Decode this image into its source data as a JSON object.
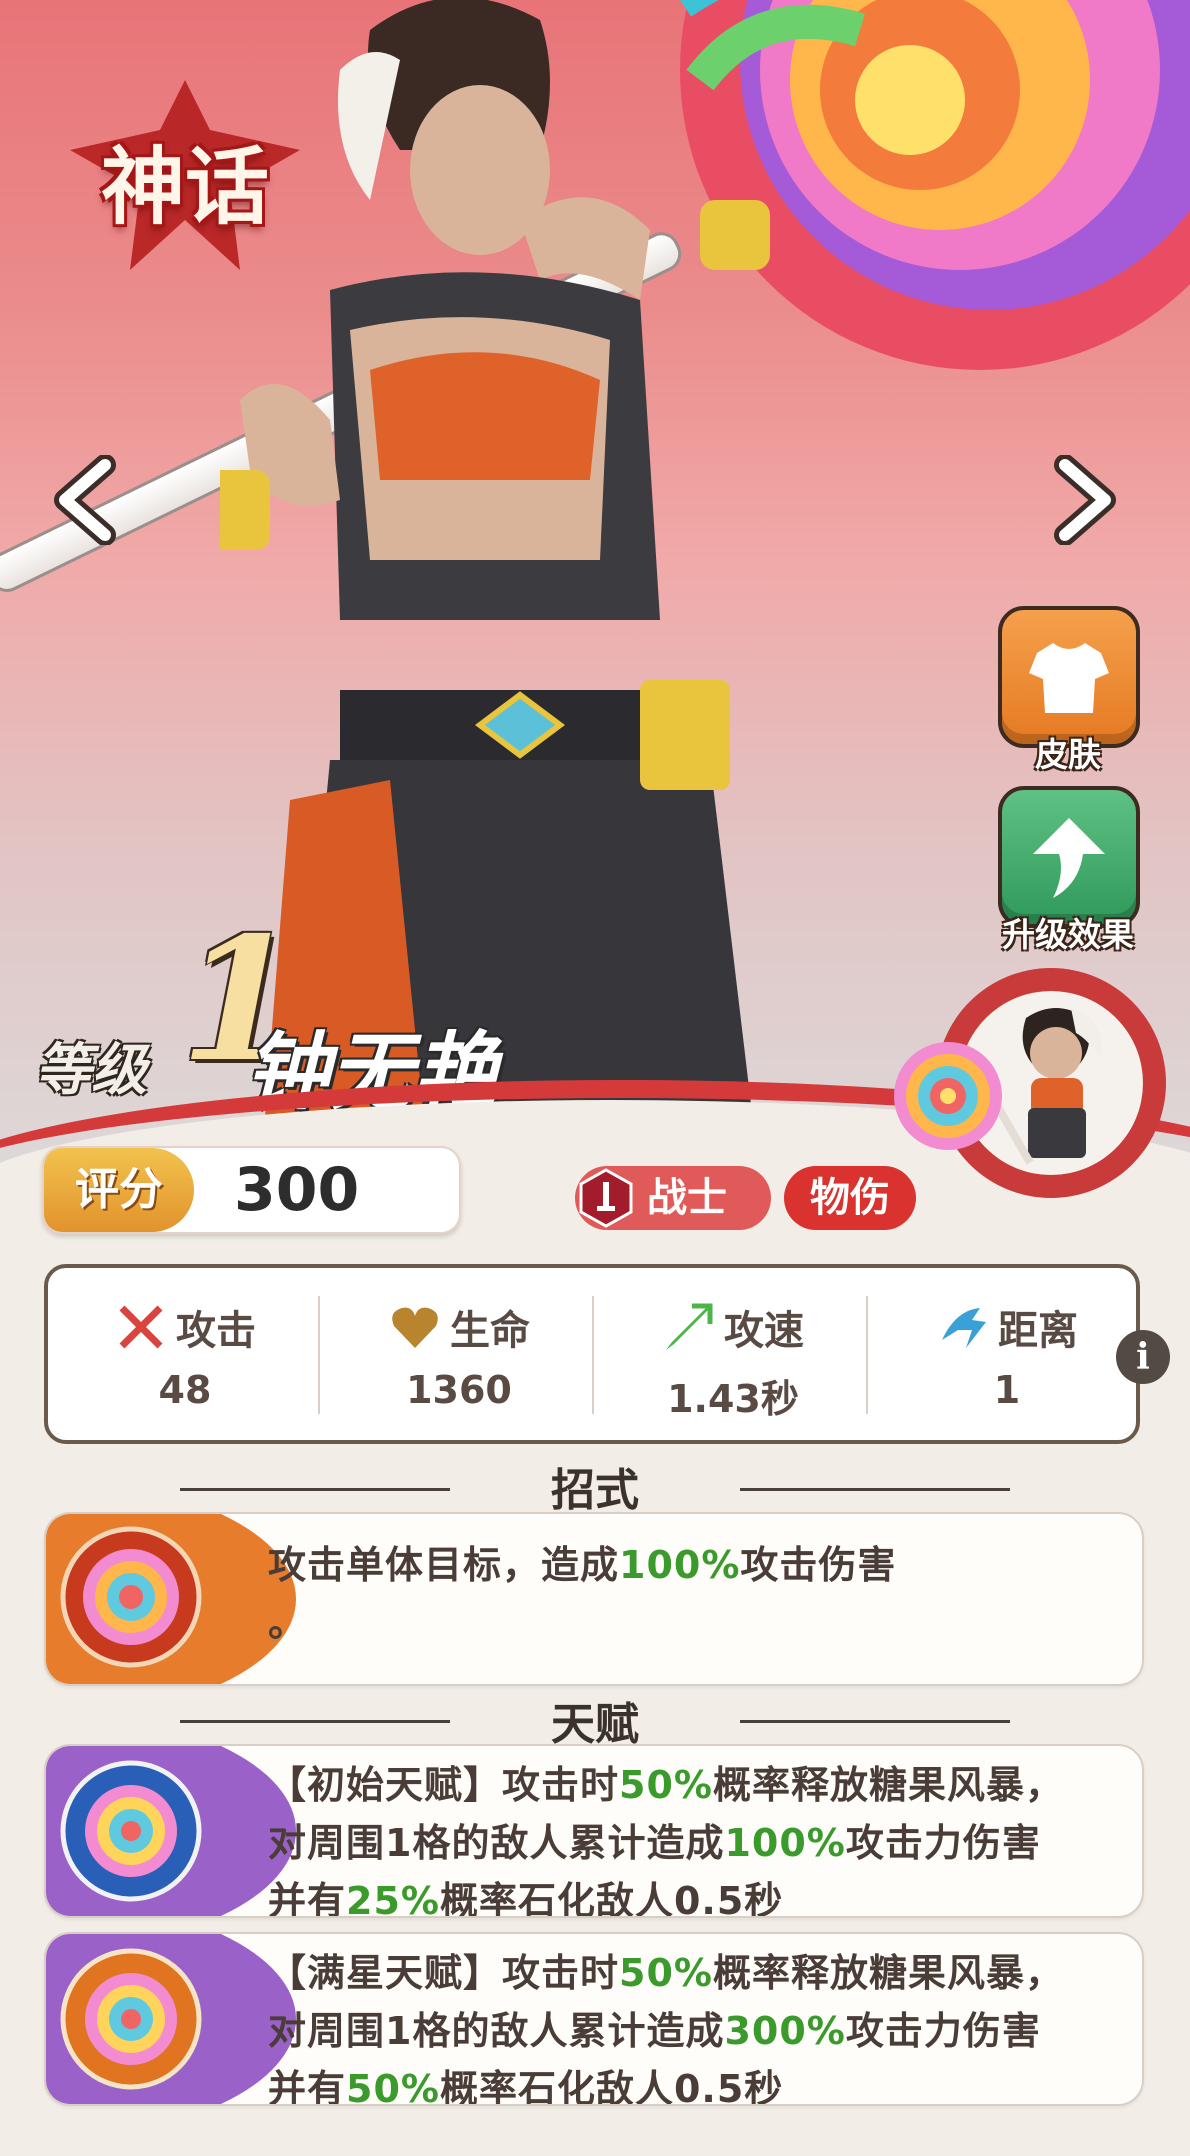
{
  "hero": {
    "rarity_badge": "神话",
    "level_label": "等级",
    "level": "1",
    "name": "钟无艳",
    "score_label": "评分",
    "score": "300",
    "class_tag": "战士",
    "damage_tag": "物伤"
  },
  "side_buttons": {
    "skin": "皮肤",
    "upgrade": "升级效果"
  },
  "stats": [
    {
      "name": "攻击",
      "value": "48",
      "icon": "attack-sword-icon"
    },
    {
      "name": "生命",
      "value": "1360",
      "icon": "heart-icon"
    },
    {
      "name": "攻速",
      "value": "1.43秒",
      "icon": "attack-speed-icon"
    },
    {
      "name": "距离",
      "value": "1",
      "icon": "range-icon"
    }
  ],
  "sections": {
    "moves_title": "招式",
    "talent_title": "天赋"
  },
  "move": {
    "text_a": "攻击单体目标，造成",
    "text_pct": "100%",
    "text_b": "攻击伤害",
    "text_c": "。"
  },
  "talent_initial": {
    "line1_a": "【初始天赋】攻击时",
    "line1_pct": "50%",
    "line1_b": "概率释放糖果风暴，",
    "line2_a": "对周围1格的敌人累计造成",
    "line2_pct": "100%",
    "line2_b": "攻击力伤害",
    "line3_a": "并有",
    "line3_pct": "25%",
    "line3_b": "概率石化敌人0.5秒"
  },
  "talent_full": {
    "line1_a": "【满星天赋】攻击时",
    "line1_pct": "50%",
    "line1_b": "概率释放糖果风暴，",
    "line2_a": "对周围1格的敌人累计造成",
    "line2_pct": "300%",
    "line2_b": "攻击力伤害",
    "line3_a": "并有",
    "line3_pct": "50%",
    "line3_b": "概率石化敌人0.5秒"
  },
  "colors": {
    "accent_red": "#d43a3a",
    "highlight_green": "#3a9b2c",
    "skin_button": "#e57a22",
    "upgrade_button": "#2f9a5a"
  }
}
